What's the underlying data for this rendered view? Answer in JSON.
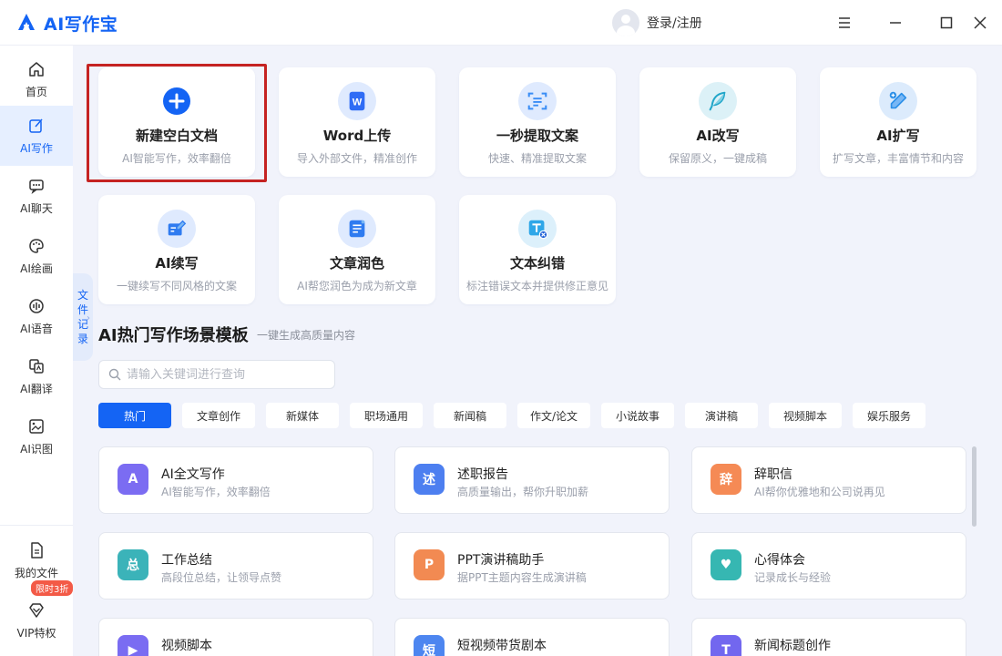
{
  "app": {
    "title": "AI写作宝",
    "login_label": "登录/注册"
  },
  "sidebar": {
    "items": [
      {
        "label": "首页",
        "icon": "home-icon"
      },
      {
        "label": "AI写作",
        "icon": "edit-icon"
      },
      {
        "label": "AI聊天",
        "icon": "chat-icon"
      },
      {
        "label": "AI绘画",
        "icon": "palette-icon"
      },
      {
        "label": "AI语音",
        "icon": "voice-icon"
      },
      {
        "label": "AI翻译",
        "icon": "translate-icon"
      },
      {
        "label": "AI识图",
        "icon": "image-recognition-icon"
      },
      {
        "label": "我的文件",
        "icon": "file-icon"
      },
      {
        "label": "VIP特权",
        "icon": "diamond-icon"
      }
    ],
    "active_index": 1,
    "vip_badge": "限时3折"
  },
  "file_record_tab": {
    "chars": [
      "文",
      "件",
      "记",
      "录"
    ]
  },
  "tools": [
    {
      "title": "新建空白文档",
      "sub": "AI智能写作，效率翻倍",
      "icon": "plus-circle-icon",
      "color": "#1464f4"
    },
    {
      "title": "Word上传",
      "sub": "导入外部文件，精准创作",
      "icon": "word-icon",
      "color": "#2f6cf5"
    },
    {
      "title": "一秒提取文案",
      "sub": "快速、精准提取文案",
      "icon": "scan-text-icon",
      "color": "#3a8df5"
    },
    {
      "title": "AI改写",
      "sub": "保留原义，一键成稿",
      "icon": "feather-icon",
      "color": "#21a6c9"
    },
    {
      "title": "AI扩写",
      "sub": "扩写文章，丰富情节和内容",
      "icon": "pen-expand-icon",
      "color": "#2b8fe8"
    },
    {
      "title": "AI续写",
      "sub": "一键续写不同风格的文案",
      "icon": "book-pen-icon",
      "color": "#2f7bf0"
    },
    {
      "title": "文章润色",
      "sub": "AI帮您润色为成为新文章",
      "icon": "document-polish-icon",
      "color": "#2f7bf0"
    },
    {
      "title": "文本纠错",
      "sub": "标注错误文本并提供修正意见",
      "icon": "text-correct-icon",
      "color": "#2fa7e8"
    }
  ],
  "templates": {
    "title": "AI热门写作场景模板",
    "subtitle": "一键生成高质量内容",
    "search_placeholder": "请输入关键词进行查询",
    "categories": [
      "热门",
      "文章创作",
      "新媒体",
      "职场通用",
      "新闻稿",
      "作文/论文",
      "小说故事",
      "演讲稿",
      "视频脚本",
      "娱乐服务"
    ],
    "active_category": 0,
    "cards": [
      {
        "title": "AI全文写作",
        "sub": "AI智能写作，效率翻倍",
        "icon": "ai-write-icon",
        "color": "#7b6cf2",
        "glyph": "A"
      },
      {
        "title": "述职报告",
        "sub": "高质量输出，帮你升职加薪",
        "icon": "report-icon",
        "color": "#4d7ff0",
        "glyph": "述"
      },
      {
        "title": "辞职信",
        "sub": "AI帮你优雅地和公司说再见",
        "icon": "resign-icon",
        "color": "#f58a55",
        "glyph": "辞"
      },
      {
        "title": "工作总结",
        "sub": "高段位总结，让领导点赞",
        "icon": "summary-icon",
        "color": "#3bb3b9",
        "glyph": "总"
      },
      {
        "title": "PPT演讲稿助手",
        "sub": "据PPT主题内容生成演讲稿",
        "icon": "ppt-icon",
        "color": "#f28a52",
        "glyph": "P"
      },
      {
        "title": "心得体会",
        "sub": "记录成长与经验",
        "icon": "notebook-icon",
        "color": "#36b7b2",
        "glyph": "♥"
      },
      {
        "title": "视频脚本",
        "sub": "",
        "icon": "video-script-icon",
        "color": "#7a6cf2",
        "glyph": "▶"
      },
      {
        "title": "短视频带货剧本",
        "sub": "",
        "icon": "short-video-icon",
        "color": "#4d86f0",
        "glyph": "短"
      },
      {
        "title": "新闻标题创作",
        "sub": "",
        "icon": "news-title-icon",
        "color": "#7267ef",
        "glyph": "T"
      }
    ]
  }
}
